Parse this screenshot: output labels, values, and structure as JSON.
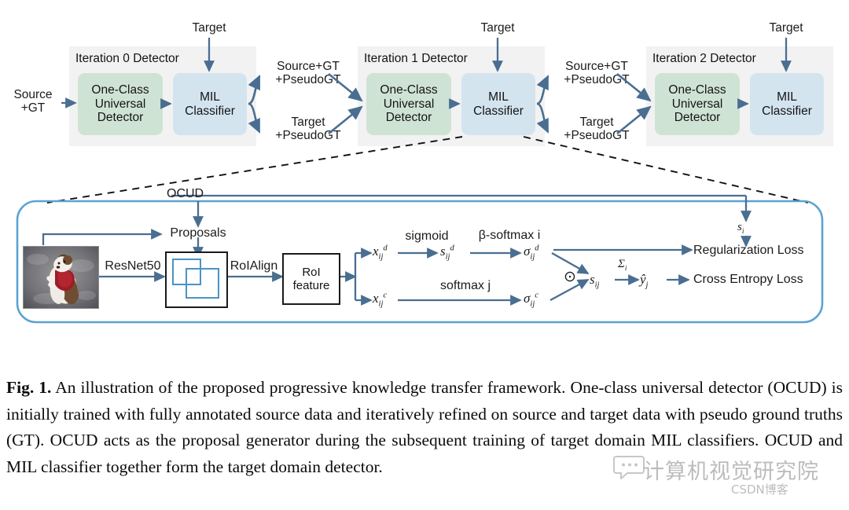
{
  "figure": {
    "top_flow": {
      "inputs": [
        {
          "id": "source-gt",
          "text": "Source\n+GT"
        },
        {
          "id": "target-0",
          "text": "Target"
        },
        {
          "id": "target-1",
          "text": "Target"
        },
        {
          "id": "target-2",
          "text": "Target"
        }
      ],
      "iterations": [
        {
          "title": "Iteration 0 Detector",
          "ocud": "One-Class\nUniversal\nDetector",
          "mil": "MIL\nClassifier"
        },
        {
          "title": "Iteration 1 Detector",
          "ocud": "One-Class\nUniversal\nDetector",
          "mil": "MIL\nClassifier"
        },
        {
          "title": "Iteration 2 Detector",
          "ocud": "One-Class\nUniversal\nDetector",
          "mil": "MIL\nClassifier"
        }
      ],
      "transfer_labels": [
        {
          "id": "transfer-0-source",
          "text": "Source+GT\n+PseudoGT"
        },
        {
          "id": "transfer-0-target",
          "text": "Target\n+PseudoGT"
        },
        {
          "id": "transfer-1-source",
          "text": "Source+GT\n+PseudoGT"
        },
        {
          "id": "transfer-1-target",
          "text": "Target\n+PseudoGT"
        }
      ]
    },
    "detail": {
      "ocud_label": "OCUD",
      "proposals_label": "Proposals",
      "backbone_label": "ResNet50",
      "roialign_label": "RoIAlign",
      "roi_feature_label": "RoI\nfeature",
      "branch_d_input": "x",
      "branch_d_input_sub": "ij",
      "branch_d_input_sup": "d",
      "sigmoid_label": "sigmoid",
      "beta_softmax_label": "β-softmax i",
      "softmax_label": "softmax j",
      "s_d": "s",
      "sigma_d": "σ",
      "branch_c_input": "x",
      "sigma_c": "σ",
      "hadamard_symbol": "⊙",
      "s_ij": "s",
      "sum_i": "Σ",
      "y_hat": "ŷ",
      "s_i": "s",
      "losses": [
        {
          "id": "regularization-loss",
          "text": "Regularization Loss"
        },
        {
          "id": "cross-entropy-loss",
          "text": "Cross Entropy Loss"
        }
      ]
    },
    "caption": {
      "bold_prefix": "Fig. 1.",
      "body": " An illustration of the proposed progressive knowledge transfer framework. One-class universal detector (OCUD) is initially trained with fully annotated source data and iteratively refined on source and target data with pseudo ground truths (GT). OCUD acts as the proposal generator during the subsequent training of target domain MIL classifiers. OCUD and MIL classifier together form the target domain detector."
    },
    "watermark": {
      "chinese": "计算机视觉研究院",
      "sub": "CSDN博客"
    },
    "colors": {
      "green_box": "#cfe3d5",
      "blue_box": "#d4e4ef",
      "panel_gray": "#f2f2f2",
      "arrow_blue": "#4a6e91",
      "container_blue": "#5ba3d0",
      "proposal_blue": "#4a93c4",
      "text_dark": "#141414"
    }
  }
}
